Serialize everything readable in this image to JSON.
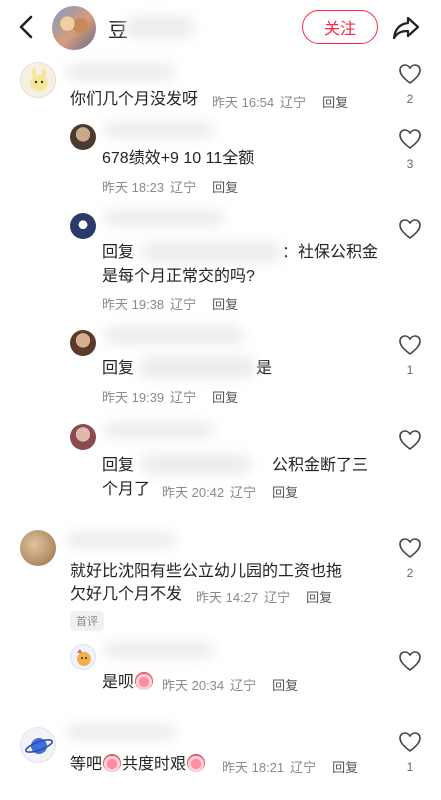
{
  "header": {
    "name_initial": "豆",
    "follow_label": "关注"
  },
  "comments": [
    {
      "text": "你们几个月没发呀",
      "time": "昨天 16:54",
      "location": "辽宁",
      "reply": "回复",
      "likes": "2"
    },
    {
      "text": "678绩效+9 10 11全额",
      "time": "昨天 18:23",
      "location": "辽宁",
      "reply": "回复",
      "likes": "3"
    },
    {
      "prefix": "回复",
      "text_after": "：社保公积金",
      "text2": "是每个月正常交的吗?",
      "time": "昨天 19:38",
      "location": "辽宁",
      "reply": "回复",
      "likes": ""
    },
    {
      "prefix": "回复",
      "text_after": "是",
      "time": "昨天 19:39",
      "location": "辽宁",
      "reply": "回复",
      "likes": "1"
    },
    {
      "prefix": "回复",
      "text_after": "公积金断了三",
      "text2": "个月了",
      "time": "昨天 20:42",
      "location": "辽宁",
      "reply": "回复",
      "likes": ""
    },
    {
      "text": "就好比沈阳有些公立幼儿园的工资也拖",
      "text2": "欠好几个月不发",
      "time": "昨天 14:27",
      "location": "辽宁",
      "reply": "回复",
      "likes": "2",
      "tag": "首评"
    },
    {
      "text": "是呗",
      "time": "昨天 20:34",
      "location": "辽宁",
      "reply": "回复",
      "likes": ""
    },
    {
      "text_a": "等吧",
      "text_b": "共度时艰",
      "time": "昨天 18:21",
      "location": "辽宁",
      "reply": "回复",
      "likes": "1"
    }
  ]
}
